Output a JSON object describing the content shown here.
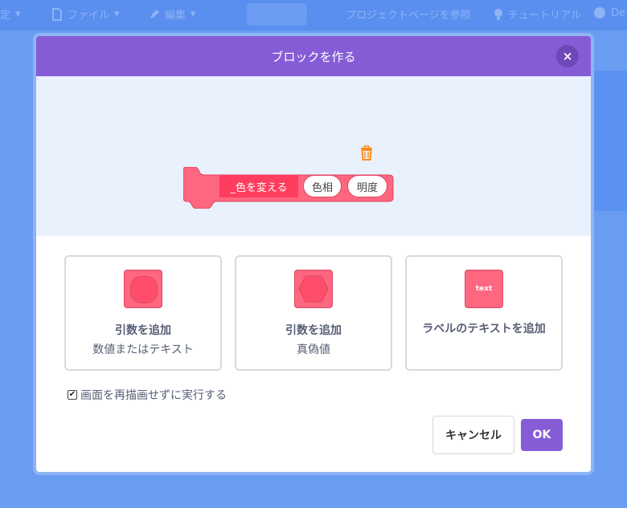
{
  "menubar": {
    "items": [
      {
        "label": "定",
        "icon": "globe-icon"
      },
      {
        "label": "ファイル",
        "icon": "file-icon"
      },
      {
        "label": "編集",
        "icon": "pencil-icon"
      },
      {
        "label": "プロジェクトページを参照",
        "icon": ""
      },
      {
        "label": "チュートリアル",
        "icon": "lightbulb-icon"
      },
      {
        "label": "De",
        "icon": "user-icon"
      }
    ]
  },
  "dialog": {
    "title": "ブロックを作る",
    "close_label": "×",
    "preview": {
      "block_label": "_色を変える",
      "arg1": "色相",
      "arg2": "明度"
    },
    "options": [
      {
        "title": "引数を追加",
        "subtitle": "数値またはテキスト"
      },
      {
        "title": "引数を追加",
        "subtitle": "真偽値"
      },
      {
        "title": "ラベルのテキストを追加",
        "icon_text": "text"
      }
    ],
    "run_without_refresh": {
      "label": "画面を再描画せずに実行する",
      "checked": true
    },
    "cancel_label": "キャンセル",
    "ok_label": "OK"
  },
  "colors": {
    "header": "#855cd6",
    "block": "#ff6680",
    "accent": "#855cd6"
  }
}
